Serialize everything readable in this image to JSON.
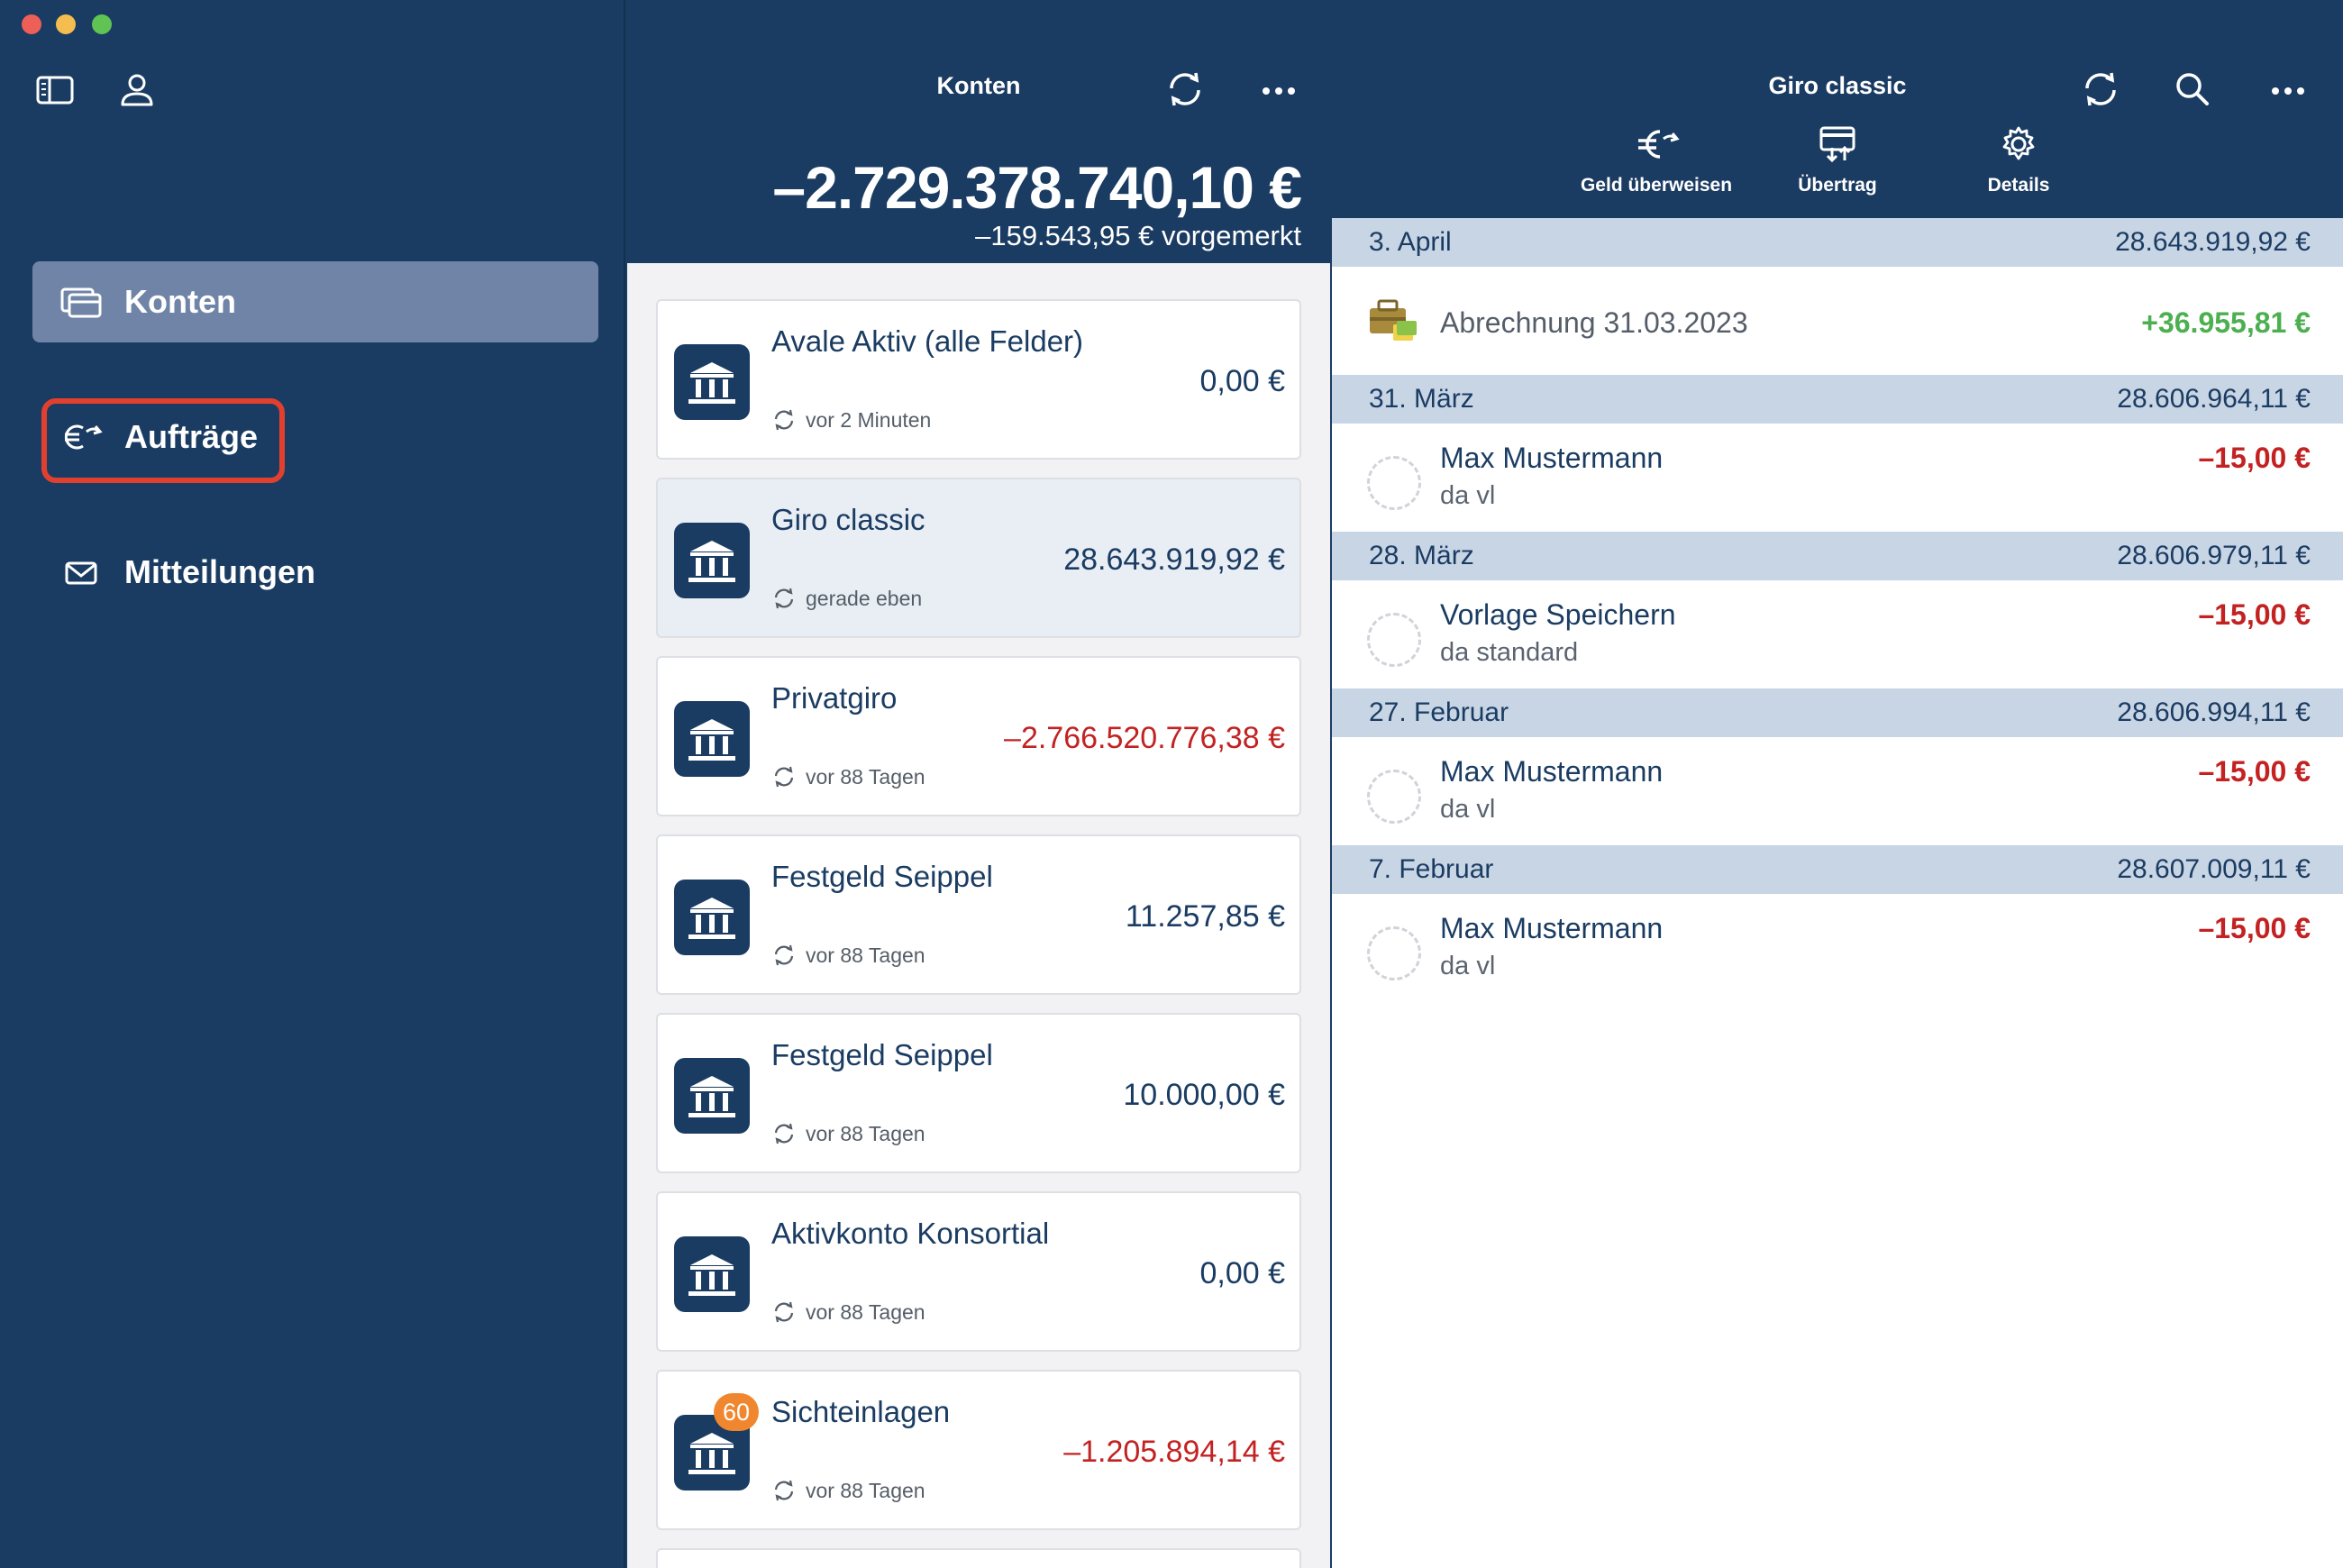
{
  "sidebar": {
    "items": [
      {
        "label": "Konten",
        "icon": "cards-icon",
        "active": true
      },
      {
        "label": "Aufträge",
        "icon": "euro-transfer-icon",
        "active": false
      },
      {
        "label": "Mitteilungen",
        "icon": "envelope-icon",
        "active": false
      }
    ],
    "toolbar_icons": [
      "sidebar-toggle-icon",
      "person-icon"
    ]
  },
  "accounts": {
    "title": "Konten",
    "total": "–2.729.378.740,10 €",
    "pending": "–159.543,95 € vorgemerkt",
    "list": [
      {
        "name": "Avale Aktiv (alle Felder)",
        "balance": "0,00 €",
        "sync": "vor 2 Minuten",
        "negative": false
      },
      {
        "name": "Giro classic",
        "balance": "28.643.919,92 €",
        "sync": "gerade eben",
        "negative": false,
        "selected": true
      },
      {
        "name": "Privatgiro",
        "balance": "–2.766.520.776,38 €",
        "sync": "vor 88 Tagen",
        "negative": true
      },
      {
        "name": "Festgeld Seippel",
        "balance": "11.257,85 €",
        "sync": "vor 88 Tagen",
        "negative": false
      },
      {
        "name": "Festgeld Seippel",
        "balance": "10.000,00 €",
        "sync": "vor 88 Tagen",
        "negative": false
      },
      {
        "name": "Aktivkonto Konsortial",
        "balance": "0,00 €",
        "sync": "vor 88 Tagen",
        "negative": false
      },
      {
        "name": "Sichteinlagen",
        "balance": "–1.205.894,14 €",
        "sync": "vor 88 Tagen",
        "negative": true,
        "badge": "60"
      }
    ]
  },
  "detail": {
    "title": "Giro classic",
    "actions": [
      {
        "label": "Geld überweisen",
        "icon": "euro-transfer-icon"
      },
      {
        "label": "Übertrag",
        "icon": "card-transfer-icon"
      },
      {
        "label": "Details",
        "icon": "gear-icon"
      }
    ],
    "groups": [
      {
        "date": "3. April",
        "balance": "28.643.919,92 €",
        "transactions": [
          {
            "title": "Abrechnung 31.03.2023",
            "subtitle": "",
            "amount": "+36.955,81 €",
            "positive": true
          }
        ]
      },
      {
        "date": "31. März",
        "balance": "28.606.964,11 €",
        "transactions": [
          {
            "title": "Max Mustermann",
            "subtitle": "da vl",
            "amount": "–15,00 €"
          }
        ]
      },
      {
        "date": "28. März",
        "balance": "28.606.979,11 €",
        "transactions": [
          {
            "title": "Vorlage Speichern",
            "subtitle": "da standard",
            "amount": "–15,00 €"
          }
        ]
      },
      {
        "date": "27. Februar",
        "balance": "28.606.994,11 €",
        "transactions": [
          {
            "title": "Max Mustermann",
            "subtitle": "da vl",
            "amount": "–15,00 €"
          }
        ]
      },
      {
        "date": "7. Februar",
        "balance": "28.607.009,11 €",
        "transactions": [
          {
            "title": "Max Mustermann",
            "subtitle": "da vl",
            "amount": "–15,00 €"
          }
        ]
      }
    ]
  },
  "colors": {
    "navy": "#1b3c62",
    "active_nav": "#6f84a6",
    "highlight_box": "#e2402f",
    "negative": "#c32222",
    "positive": "#4caf50",
    "badge": "#f0872f",
    "date_row": "#c8d5e5"
  }
}
